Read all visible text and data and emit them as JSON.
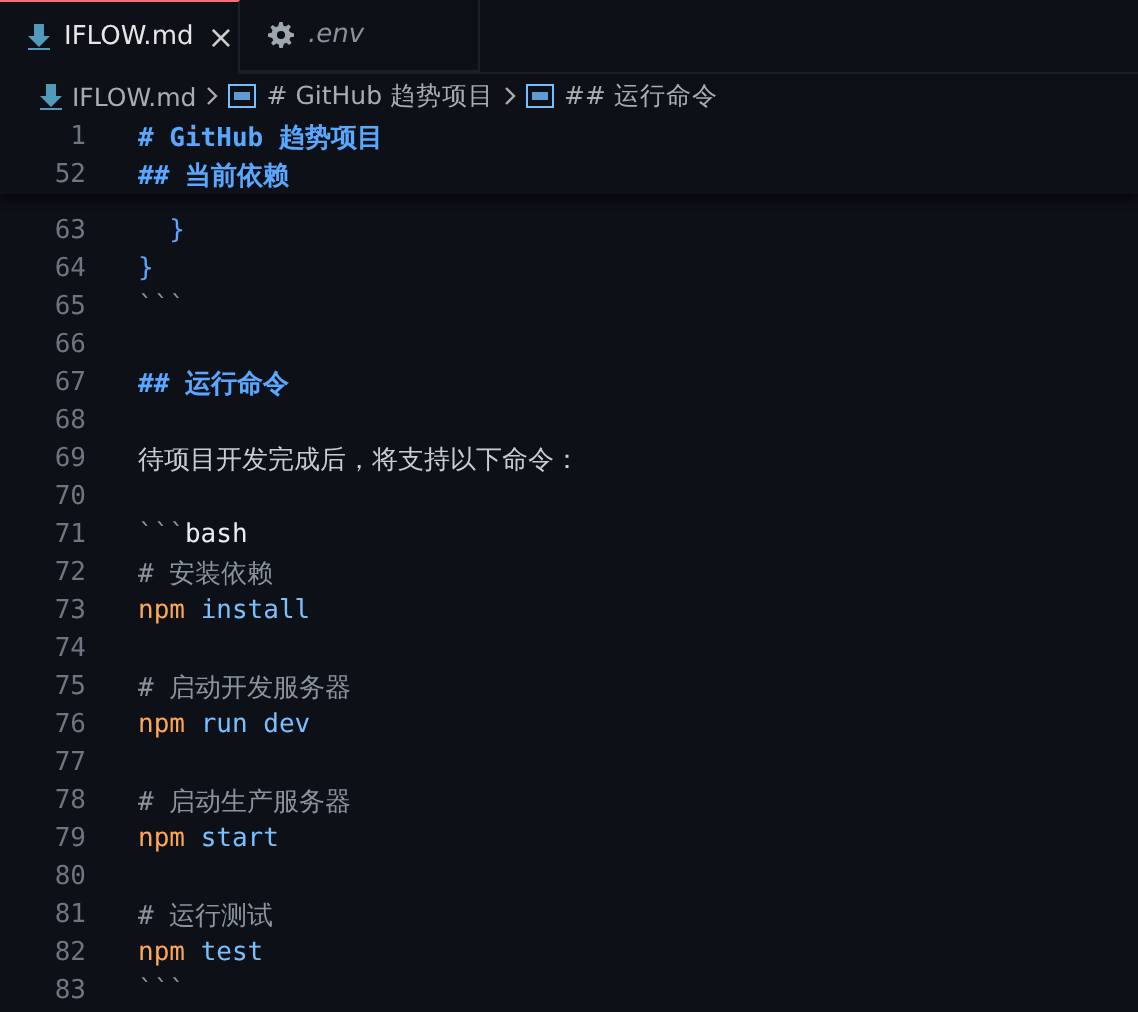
{
  "tabs": [
    {
      "label": "IFLOW.md",
      "kind": "markdown",
      "selected": true,
      "preview": false,
      "close": "×"
    },
    {
      "label": ".env",
      "kind": "settings",
      "selected": false,
      "preview": true
    }
  ],
  "breadcrumbs": [
    {
      "label": "IFLOW.md",
      "kind": "markdown"
    },
    {
      "label": "# GitHub 趋势项目",
      "kind": "symbol"
    },
    {
      "label": "## 运行命令",
      "kind": "symbol"
    }
  ],
  "sticky_lines": [
    {
      "number": "1",
      "kind": "heading",
      "text": "# GitHub 趋势项目"
    },
    {
      "number": "52",
      "kind": "heading",
      "text": "## 当前依赖"
    }
  ],
  "lines": [
    {
      "number": "63",
      "kind": "brace",
      "text": "  }"
    },
    {
      "number": "64",
      "kind": "brace",
      "text": "}"
    },
    {
      "number": "65",
      "kind": "fence",
      "marker": "```"
    },
    {
      "number": "66",
      "kind": "blank"
    },
    {
      "number": "67",
      "kind": "heading",
      "text": "## 运行命令"
    },
    {
      "number": "68",
      "kind": "blank"
    },
    {
      "number": "69",
      "kind": "text",
      "text": "待项目开发完成后，将支持以下命令："
    },
    {
      "number": "70",
      "kind": "blank"
    },
    {
      "number": "71",
      "kind": "fence",
      "marker": "```",
      "lang": "bash"
    },
    {
      "number": "72",
      "kind": "comment",
      "text": "# 安装依赖"
    },
    {
      "number": "73",
      "kind": "command",
      "command": "npm",
      "args": "install"
    },
    {
      "number": "74",
      "kind": "blank"
    },
    {
      "number": "75",
      "kind": "comment",
      "text": "# 启动开发服务器"
    },
    {
      "number": "76",
      "kind": "command",
      "command": "npm",
      "args": "run dev"
    },
    {
      "number": "77",
      "kind": "blank"
    },
    {
      "number": "78",
      "kind": "comment",
      "text": "# 启动生产服务器"
    },
    {
      "number": "79",
      "kind": "command",
      "command": "npm",
      "args": "start"
    },
    {
      "number": "80",
      "kind": "blank"
    },
    {
      "number": "81",
      "kind": "comment",
      "text": "# 运行测试"
    },
    {
      "number": "82",
      "kind": "command",
      "command": "npm",
      "args": "test"
    },
    {
      "number": "83",
      "kind": "fence",
      "marker": "```"
    }
  ]
}
